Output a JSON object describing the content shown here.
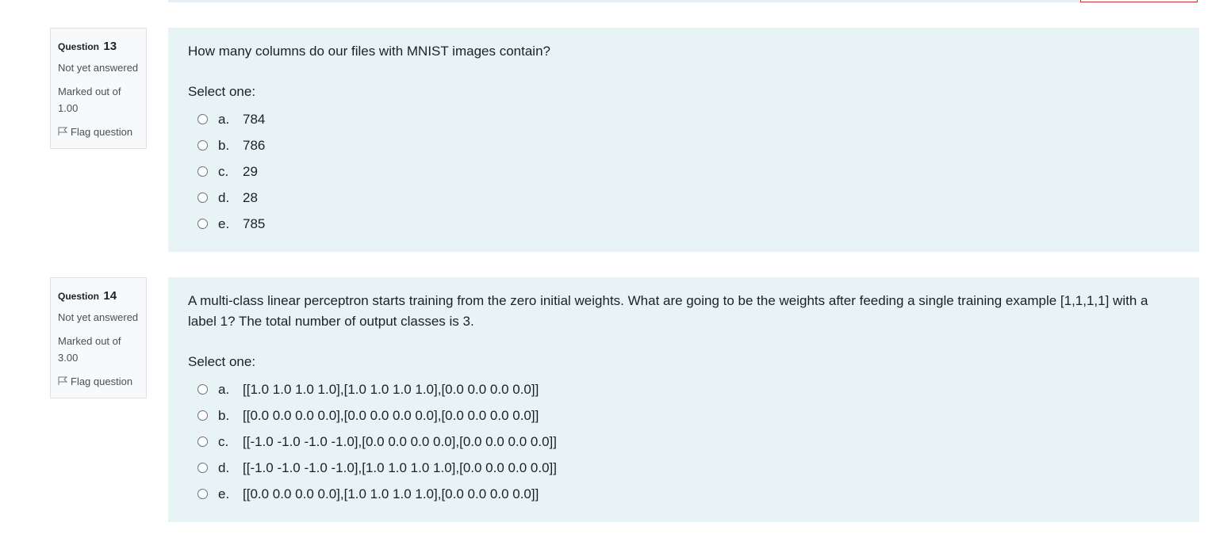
{
  "questions": [
    {
      "label": "Question",
      "number": "13",
      "status": "Not yet answered",
      "marks": "Marked out of 1.00",
      "flag": "Flag question",
      "text": "How many columns do our files with MNIST images contain?",
      "prompt": "Select one:",
      "options": [
        {
          "letter": "a.",
          "text": "784"
        },
        {
          "letter": "b.",
          "text": "786"
        },
        {
          "letter": "c.",
          "text": "29"
        },
        {
          "letter": "d.",
          "text": "28"
        },
        {
          "letter": "e.",
          "text": "785"
        }
      ]
    },
    {
      "label": "Question",
      "number": "14",
      "status": "Not yet answered",
      "marks": "Marked out of 3.00",
      "flag": "Flag question",
      "text": "A multi-class linear perceptron starts training from the zero initial weights. What are going to be the weights after feeding a single training example [1,1,1,1] with a label 1? The total number of output classes is 3.",
      "prompt": "Select one:",
      "options": [
        {
          "letter": "a.",
          "text": "[[1.0 1.0 1.0 1.0],[1.0 1.0 1.0 1.0],[0.0 0.0 0.0 0.0]]"
        },
        {
          "letter": "b.",
          "text": "[[0.0 0.0 0.0 0.0],[0.0 0.0 0.0 0.0],[0.0 0.0 0.0 0.0]]"
        },
        {
          "letter": "c.",
          "text": "[[-1.0 -1.0 -1.0 -1.0],[0.0 0.0 0.0 0.0],[0.0 0.0 0.0 0.0]]"
        },
        {
          "letter": "d.",
          "text": "[[-1.0 -1.0 -1.0 -1.0],[1.0 1.0 1.0 1.0],[0.0 0.0 0.0 0.0]]"
        },
        {
          "letter": "e.",
          "text": "[[0.0 0.0 0.0 0.0],[1.0 1.0 1.0 1.0],[0.0 0.0 0.0 0.0]]"
        }
      ]
    }
  ],
  "colors": {
    "content_background": "#e7f3f5",
    "info_background": "#f8f9fa",
    "border": "#dee2e6",
    "text": "#1d2125",
    "muted_text": "#495057"
  },
  "icons": {
    "flag": "flag-outline-icon",
    "radio": "radio-unchecked-icon"
  }
}
